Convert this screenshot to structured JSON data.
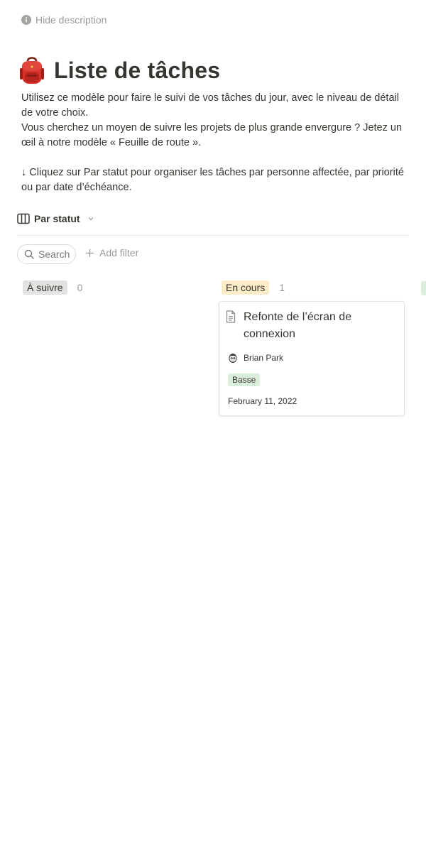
{
  "description_toggle": {
    "label": "Hide description",
    "icon": "info-icon"
  },
  "page": {
    "icon": "backpack-icon",
    "title": "Liste de tâches",
    "description": {
      "line1": "Utilisez ce modèle pour faire le suivi de vos tâches du jour, avec le niveau de détail de votre choix.",
      "line2": "Vous cherchez un moyen de suivre les projets de plus grande envergure ? Jetez un œil à notre modèle « Feuille de route ».",
      "line3": "↓ Cliquez sur Par statut pour organiser les tâches par personne affectée, par priorité ou par date d’échéance."
    }
  },
  "view": {
    "icon": "board-icon",
    "label": "Par statut",
    "chevron": "chevron-down-icon"
  },
  "toolbar": {
    "search_label": "Search",
    "search_icon": "search-icon",
    "add_filter_label": "Add filter",
    "add_filter_icon": "plus-icon"
  },
  "columns": [
    {
      "label": "À suivre",
      "count": "0",
      "color": "#e3e2e0"
    },
    {
      "label": "En cours",
      "count": "1",
      "color": "#fdecc8"
    },
    {
      "label": "",
      "count": "",
      "color": "#dbeddb"
    }
  ],
  "cards": [
    {
      "icon": "document-icon",
      "title": "Refonte de l’écran de connexion",
      "assignee": "Brian Park",
      "assignee_icon": "avatar-icon",
      "priority": "Basse",
      "priority_color": "#dbeddb",
      "date": "February 11, 2022"
    }
  ]
}
